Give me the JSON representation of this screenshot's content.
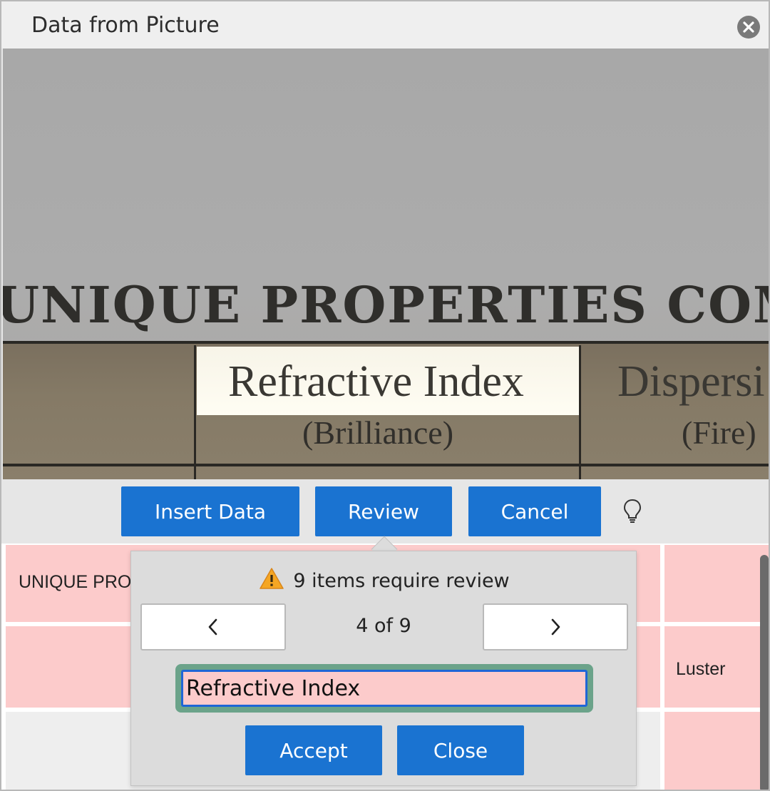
{
  "window": {
    "title": "Data from Picture"
  },
  "photo": {
    "headline": "UNIQUE PROPERTIES COMPAR",
    "col1_title": "Refractive Index",
    "col1_sub": "(Brilliance)",
    "col2_title": "Dispersi",
    "col2_sub": "(Fire)"
  },
  "toolbar": {
    "insert_label": "Insert Data",
    "review_label": "Review",
    "cancel_label": "Cancel"
  },
  "grid": {
    "row1_cell1": "UNIQUE PRO",
    "row2_cell_last": "Luster"
  },
  "review": {
    "message": "9 items require review",
    "counter": "4 of 9",
    "prev_symbol": "<",
    "next_symbol": ">",
    "field_value": "Refractive Index ",
    "accept_label": "Accept",
    "close_label": "Close"
  },
  "colors": {
    "accent": "#1a73d1",
    "needs_review": "#fccbcb",
    "field_focus": "#1f66d6"
  }
}
